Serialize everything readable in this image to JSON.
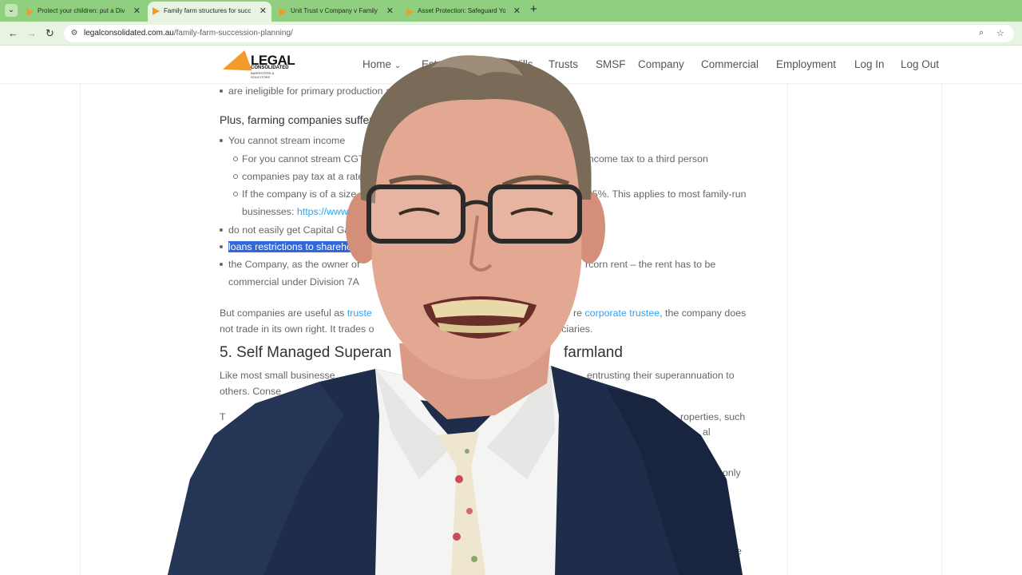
{
  "browser": {
    "tabs": [
      {
        "title": "Protect your children: put a Div",
        "active": false
      },
      {
        "title": "Family farm structures for succ",
        "active": true
      },
      {
        "title": "Unit Trust v Company v Family",
        "active": false
      },
      {
        "title": "Asset Protection: Safeguard You",
        "active": false
      }
    ],
    "url_domain": "legalconsolidated.com.au",
    "url_path": "/family-farm-succession-planning/"
  },
  "site": {
    "logo_text": "LEGAL",
    "logo_sub1": "CONSOLIDATED",
    "logo_sub2": "BARRISTERS & SOLICITORS",
    "menu": [
      "Home",
      "Estate Planning & Wills",
      "Trusts",
      "SMSF",
      "Company",
      "Commercial",
      "Employment",
      "Log In",
      "Log Out"
    ]
  },
  "article": {
    "b1": "are ineligible for primary production averaging",
    "plus_heading": "Plus, farming companies suffer in",
    "stream": "You cannot stream income",
    "sub1_a": "For you cannot stream CGT to",
    "sub1_b": "income tax to a third person",
    "sub2": "companies pay tax at a rate",
    "sub3_a": "If the company is of a size",
    "sub3_b": "25%. This applies to most family-run",
    "sub3_c": "businesses:",
    "sub3_link": "https://www.a",
    "cgt": "do not easily get Capital Gains",
    "loans": "loans restrictions to shareholde",
    "company_a": "the Company, as the owner of",
    "company_b": "rcorn rent – the rent has to be",
    "company_c": "commercial under Division 7A",
    "but_a": "But companies are useful as",
    "but_link1": "truste",
    "but_b": "re",
    "but_link2": "corporate trustee",
    "but_c": ", the company does",
    "but_d": "not trade in its own right. It trades o",
    "but_e": "ficiaries.",
    "h5_a": "5. Self Managed Superan",
    "h5_b": "farmland",
    "like_a": "Like most small businesse",
    "like_b": "entrusting their superannuation to",
    "like_c": "others. Conse",
    "frag1": "T",
    "frag2": "roperties, such",
    "frag3": "al",
    "frag4": "only",
    "frag5": "e"
  }
}
